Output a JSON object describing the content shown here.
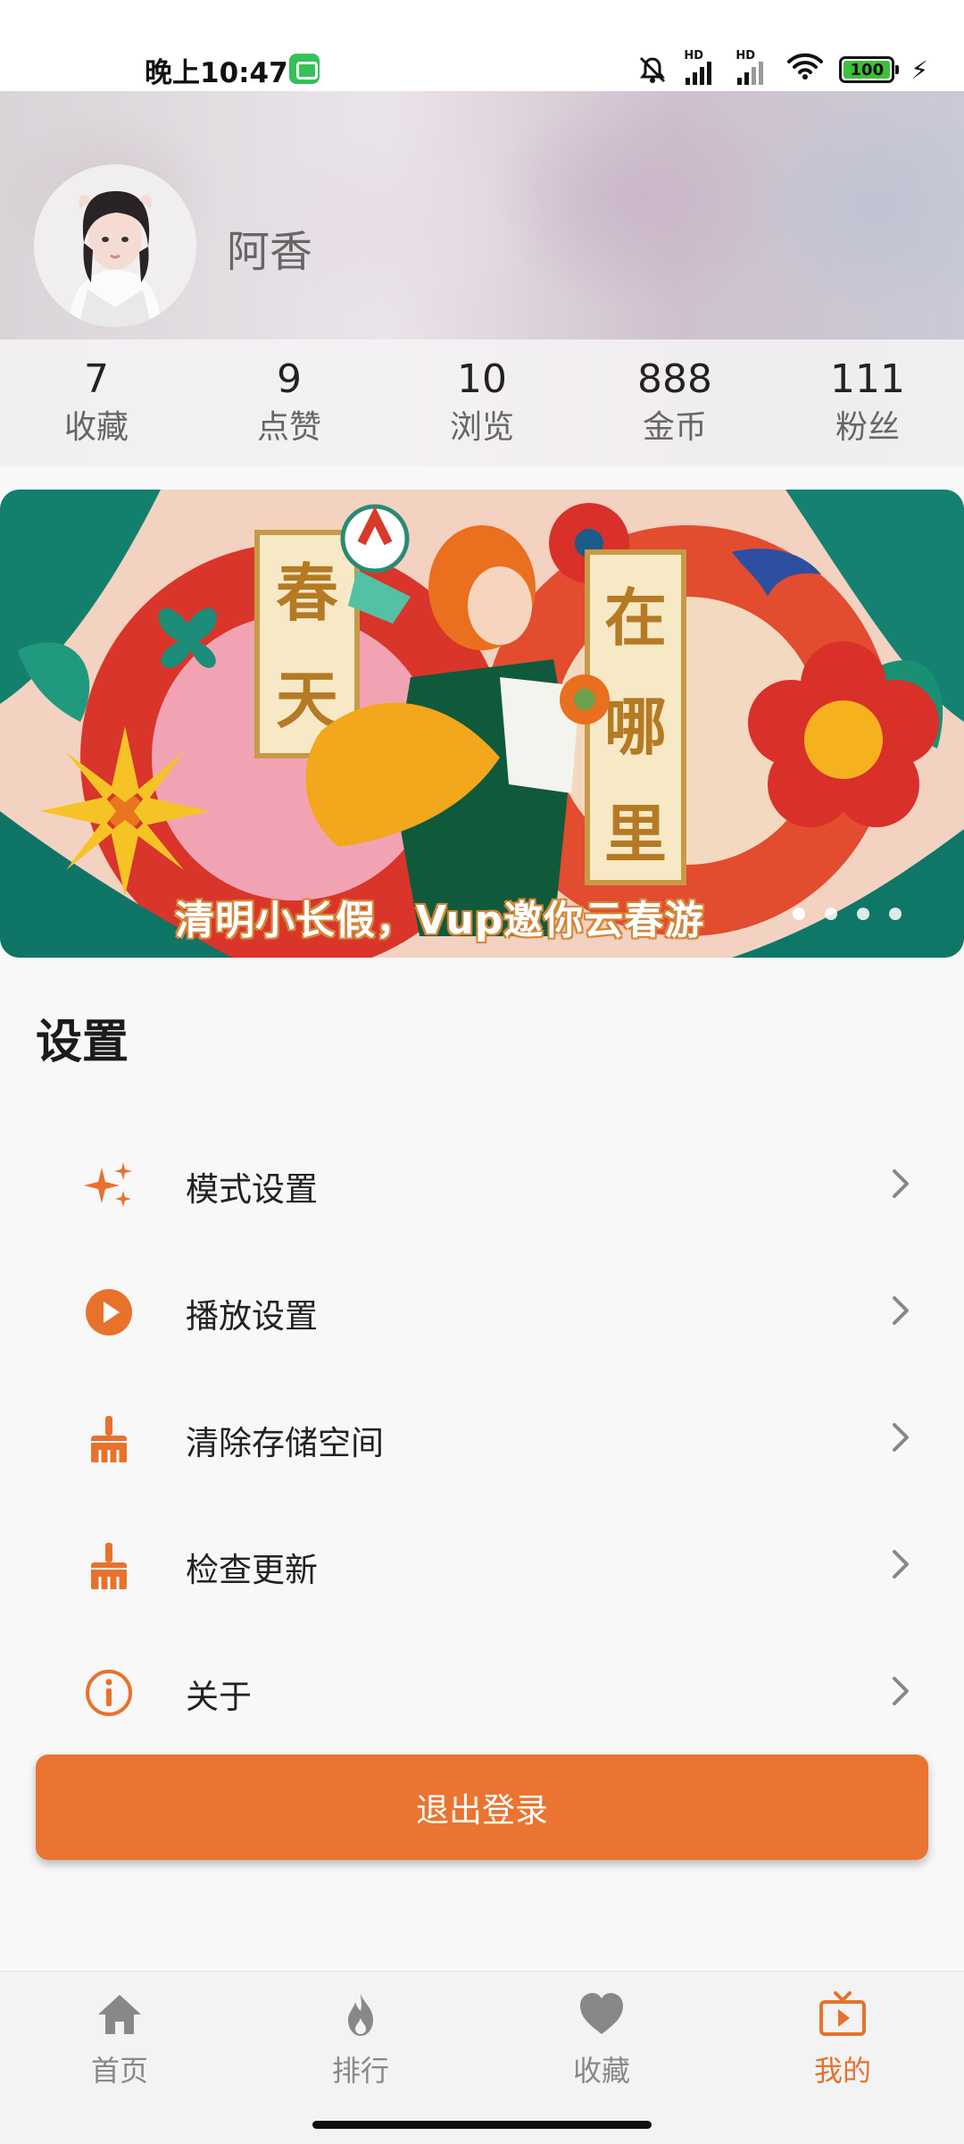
{
  "status_bar": {
    "time": "晚上10:47",
    "signal_label": "HD",
    "battery": "100"
  },
  "profile": {
    "name": "阿香"
  },
  "stats": [
    {
      "value": "7",
      "label": "收藏"
    },
    {
      "value": "9",
      "label": "点赞"
    },
    {
      "value": "10",
      "label": "浏览"
    },
    {
      "value": "888",
      "label": "金币"
    },
    {
      "value": "111",
      "label": "粉丝"
    }
  ],
  "banner": {
    "caption": "清明小长假，Vup邀你云春游",
    "art_text_left": [
      "春",
      "天"
    ],
    "art_text_right": [
      "在",
      "哪",
      "里"
    ],
    "dots": 4,
    "active_dot": 0
  },
  "settings": {
    "title": "设置",
    "items": [
      {
        "label": "模式设置",
        "icon": "sparkles-icon"
      },
      {
        "label": "播放设置",
        "icon": "play-circle-icon"
      },
      {
        "label": "清除存储空间",
        "icon": "broom-icon"
      },
      {
        "label": "检查更新",
        "icon": "broom-icon"
      },
      {
        "label": "关于",
        "icon": "info-circle-icon"
      }
    ]
  },
  "logout_label": "退出登录",
  "nav": {
    "items": [
      {
        "label": "首页",
        "icon": "home-icon"
      },
      {
        "label": "排行",
        "icon": "fire-icon"
      },
      {
        "label": "收藏",
        "icon": "heart-icon"
      },
      {
        "label": "我的",
        "icon": "tv-icon"
      }
    ],
    "active_index": 3
  },
  "colors": {
    "accent": "#e8722c",
    "inactive": "#888888"
  }
}
